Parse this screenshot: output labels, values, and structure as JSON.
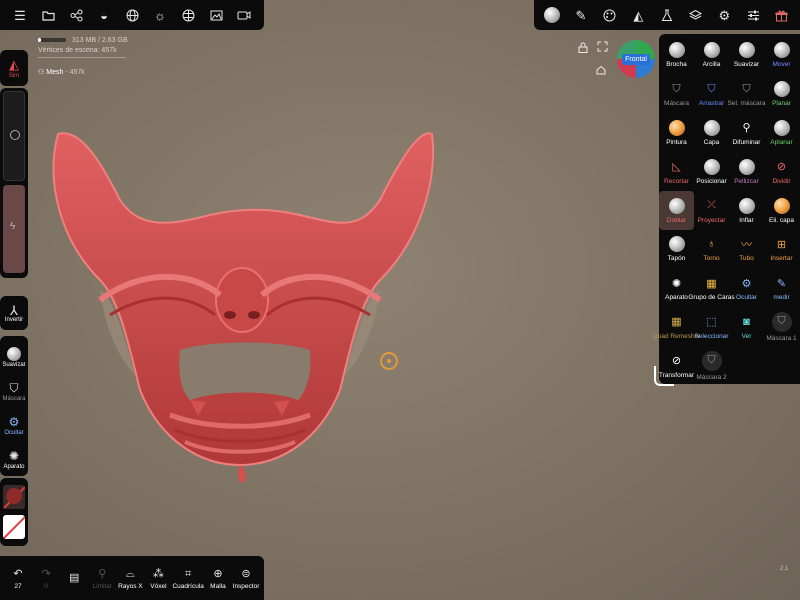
{
  "stats": {
    "memory": "313 MB / 2.63 GB",
    "memory_fraction": 0.12,
    "vertices": "Vértices de escena:  457k"
  },
  "mesh": {
    "name": "Mesh",
    "count": " - 457k"
  },
  "top_left_icons": [
    "menu-icon",
    "folder-icon",
    "scene-graph-icon",
    "sculpt-icon",
    "globe-icon",
    "sun-icon",
    "globe-grid-icon",
    "image-icon",
    "camera-icon"
  ],
  "top_right_icons": [
    "brush-sphere-icon",
    "pen-icon",
    "palette-icon",
    "triangle-icon",
    "flask-icon",
    "layers-icon",
    "gear-icon",
    "sliders-icon",
    "gift-icon"
  ],
  "left": {
    "symmetry": "Sim",
    "invert": "Invertir",
    "tools": [
      {
        "icon": "smooth-icon",
        "label": "Suavizar",
        "color": "#ffffff"
      },
      {
        "icon": "shield-icon",
        "label": "Máscara",
        "color": "#9a9a9a"
      },
      {
        "icon": "hide-icon",
        "label": "Ocultar",
        "color": "#8ab8ff"
      },
      {
        "icon": "gear-outline-icon",
        "label": "Aparato",
        "color": "#ffffff"
      }
    ]
  },
  "bottom": {
    "undo_count": "27",
    "tools": [
      {
        "icon": "undo-icon",
        "label": "27",
        "dim": false
      },
      {
        "icon": "redo-icon",
        "label": "0",
        "dim": true
      },
      {
        "icon": "book-icon",
        "label": "",
        "dim": false
      },
      {
        "icon": "search-icon",
        "label": "Limitar",
        "dim": true
      },
      {
        "icon": "xray-icon",
        "label": "Rayos X",
        "dim": false
      },
      {
        "icon": "voxel-icon",
        "label": "Vóxel",
        "dim": false
      },
      {
        "icon": "grid-icon",
        "label": "Cuadrícula",
        "dim": false
      },
      {
        "icon": "wireframe-icon",
        "label": "Malla",
        "dim": false
      },
      {
        "icon": "inspector-icon",
        "label": "Inspector",
        "dim": false
      }
    ]
  },
  "gizmo": {
    "label": "Frontal"
  },
  "version": "2.1",
  "colors": {
    "accent_selected": "#4a3834",
    "mask_red": "#c84a4a"
  },
  "tools": [
    {
      "label": "Brocha",
      "icon": "sphere",
      "color": "white"
    },
    {
      "label": "Arcilla",
      "icon": "sphere",
      "color": "white"
    },
    {
      "label": "Suavizar",
      "icon": "sphere",
      "color": "white"
    },
    {
      "label": "Mover",
      "icon": "sphere",
      "color": "blue"
    },
    {
      "label": "Máscara",
      "icon": "shield",
      "color": "gray"
    },
    {
      "label": "Arrastrar",
      "icon": "shield",
      "color": "blue"
    },
    {
      "label": "Sel. máscara",
      "icon": "shield",
      "color": "gray"
    },
    {
      "label": "Planar",
      "icon": "sphere",
      "color": "green"
    },
    {
      "label": "Pintura",
      "icon": "sphere-orange",
      "color": "white"
    },
    {
      "label": "Capa",
      "icon": "sphere",
      "color": "white"
    },
    {
      "label": "Difuminar",
      "icon": "pin",
      "color": "white"
    },
    {
      "label": "Aplanar",
      "icon": "sphere",
      "color": "green"
    },
    {
      "label": "Recortar",
      "icon": "trim",
      "color": "red"
    },
    {
      "label": "Posicionar",
      "icon": "sphere",
      "color": "white"
    },
    {
      "label": "Pellizcar",
      "icon": "sphere",
      "color": "mauve"
    },
    {
      "label": "Dividir",
      "icon": "split",
      "color": "red"
    },
    {
      "label": "Doblar",
      "icon": "sphere",
      "color": "red",
      "selected": true
    },
    {
      "label": "Proyectar",
      "icon": "project",
      "color": "red"
    },
    {
      "label": "Inflar",
      "icon": "sphere",
      "color": "white"
    },
    {
      "label": "Eli. capa",
      "icon": "sphere-orange",
      "color": "white"
    },
    {
      "label": "Tapón",
      "icon": "sphere",
      "color": "white"
    },
    {
      "label": "Torno",
      "icon": "lathe",
      "color": "orange"
    },
    {
      "label": "Tubo",
      "icon": "tube",
      "color": "orange"
    },
    {
      "label": "Insertar",
      "icon": "insert",
      "color": "orange"
    },
    {
      "label": "Aparato",
      "icon": "gizmo",
      "color": "white"
    },
    {
      "label": "Grupo de Caras",
      "icon": "facegroup",
      "color": "white"
    },
    {
      "label": "Ocultar",
      "icon": "hide",
      "color": "lightblue"
    },
    {
      "label": "medir",
      "icon": "measure",
      "color": "lightblue"
    },
    {
      "label": "Quad Remesher",
      "icon": "quad",
      "color": "gold"
    },
    {
      "label": "Seleccionar",
      "icon": "select",
      "color": "lightblue"
    },
    {
      "label": "Ver",
      "icon": "camera",
      "color": "cyan"
    },
    {
      "label": "Máscara 1",
      "icon": "shield-dark",
      "color": "gray"
    },
    {
      "label": "Transformar",
      "icon": "transform",
      "color": "white"
    },
    {
      "label": "Máscara 2",
      "icon": "shield-dark",
      "color": "gray"
    }
  ]
}
